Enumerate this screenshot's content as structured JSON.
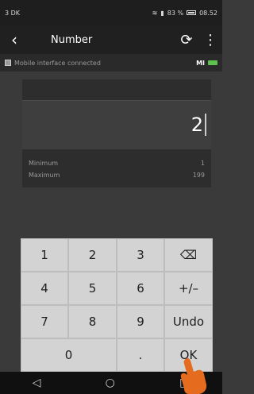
{
  "status": {
    "left": "3 DK",
    "battery": "83 %",
    "time": "08.52"
  },
  "app_bar": {
    "title": "Number"
  },
  "connection": {
    "label": "Mobile interface connected",
    "logo": "MI"
  },
  "input": {
    "value": "2"
  },
  "limits": {
    "minimum_label": "Minimum",
    "minimum_value": "1",
    "maximum_label": "Maximum",
    "maximum_value": "199"
  },
  "keypad": {
    "k1": "1",
    "k2": "2",
    "k3": "3",
    "k4": "4",
    "k5": "5",
    "k6": "6",
    "k7": "7",
    "k8": "8",
    "k9": "9",
    "k0": "0",
    "dot": ".",
    "plusminus": "+/–",
    "undo": "Undo",
    "ok": "OK"
  }
}
